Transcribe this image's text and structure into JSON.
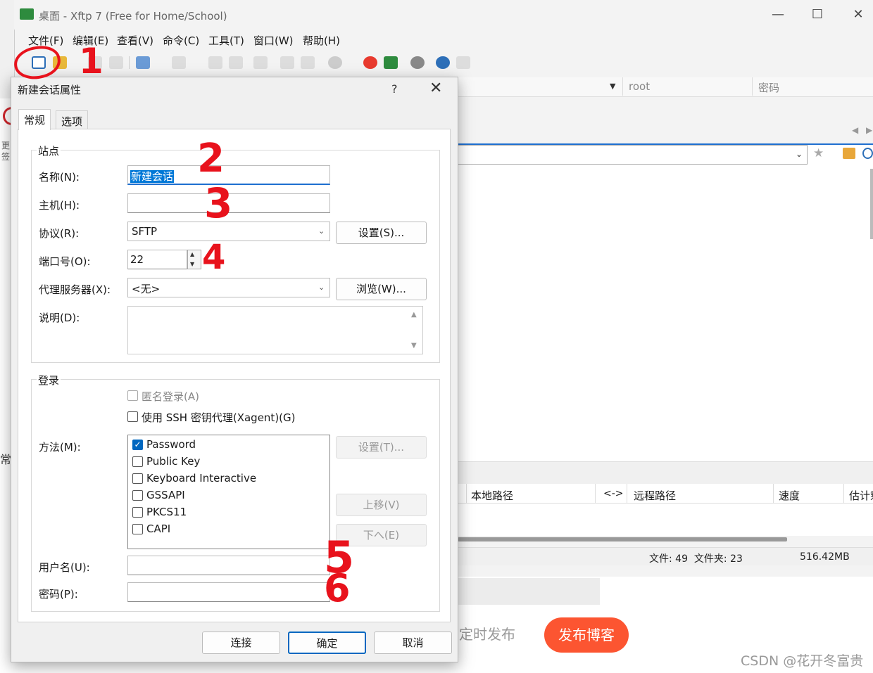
{
  "window": {
    "title": "桌面 - Xftp 7 (Free for Home/School)",
    "minimize": "—",
    "maximize": "☐",
    "close": "✕"
  },
  "menu": [
    "文件(F)",
    "编辑(E)",
    "查看(V)",
    "命令(C)",
    "工具(T)",
    "窗口(W)",
    "帮助(H)"
  ],
  "right_pane": {
    "user_field": "root",
    "password_field": "密码",
    "transfer_headers": [
      "本地路径",
      "<->",
      "远程路径",
      "速度",
      "估计剩"
    ],
    "status_counts": "文件: 49  文件夹: 23",
    "status_size": "516.42MB"
  },
  "background_page": {
    "schedule_button": "定时发布",
    "publish_button": "发布博客",
    "watermark": "CSDN @花开冬富贵",
    "side_chars": [
      "更",
      "签",
      "常"
    ]
  },
  "dialog": {
    "title": "新建会话属性",
    "help": "?",
    "close": "✕",
    "tabs": [
      "常规",
      "选项"
    ],
    "site_group": "站点",
    "name_label": "名称(N):",
    "name_value": "新建会话",
    "host_label": "主机(H):",
    "host_value": "",
    "protocol_label": "协议(R):",
    "protocol_value": "SFTP",
    "settings_button": "设置(S)...",
    "port_label": "端口号(O):",
    "port_value": "22",
    "proxy_label": "代理服务器(X):",
    "proxy_value": "<无>",
    "browse_button": "浏览(W)...",
    "desc_label": "说明(D):",
    "desc_value": "",
    "login_group": "登录",
    "anonymous_label": "匿名登录(A)",
    "xagent_label": "使用 SSH 密钥代理(Xagent)(G)",
    "method_label": "方法(M):",
    "methods": [
      {
        "label": "Password",
        "checked": true
      },
      {
        "label": "Public Key",
        "checked": false
      },
      {
        "label": "Keyboard Interactive",
        "checked": false
      },
      {
        "label": "GSSAPI",
        "checked": false
      },
      {
        "label": "PKCS11",
        "checked": false
      },
      {
        "label": "CAPI",
        "checked": false
      }
    ],
    "method_settings_button": "设置(T)...",
    "move_up_button": "上移(V)",
    "move_down_button": "下へ(E)",
    "username_label": "用户名(U):",
    "username_value": "",
    "password_label": "密码(P):",
    "password_value": "",
    "connect_button": "连接",
    "ok_button": "确定",
    "cancel_button": "取消"
  },
  "annotations": [
    "1",
    "2",
    "3",
    "4",
    "5",
    "6"
  ],
  "colors": {
    "accent": "#0078d7",
    "annotation_red": "#e8121c",
    "publish_orange": "#fc5531"
  }
}
